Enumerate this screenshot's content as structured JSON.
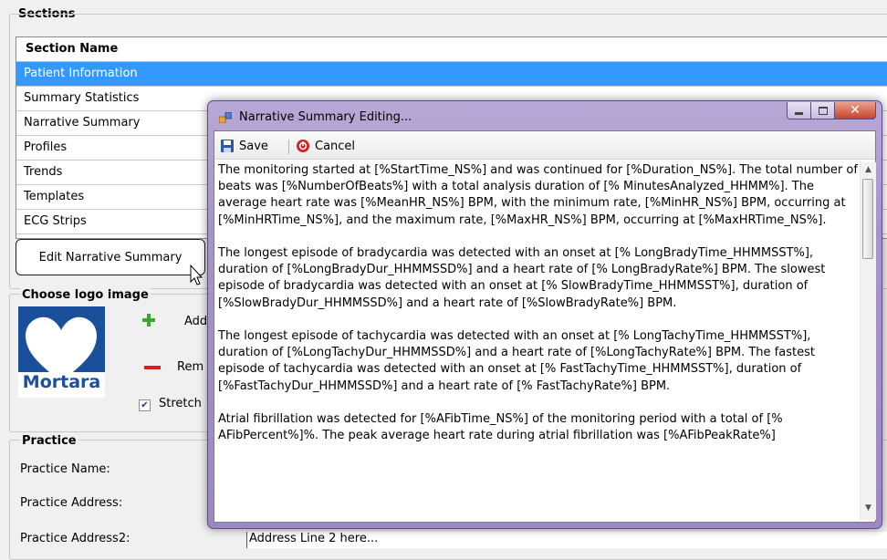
{
  "sections": {
    "title": "Sections",
    "column_header": "Section Name",
    "rows": [
      "Patient Information",
      "Summary Statistics",
      "Narrative Summary",
      "Profiles",
      "Trends",
      "Templates",
      "ECG Strips"
    ],
    "selected_index": 0,
    "edit_button": "Edit Narrative Summary"
  },
  "logo": {
    "title": "Choose logo image",
    "brand_text": "Mortara",
    "add_label": "Add",
    "remove_label": "Rem",
    "stretch_label": "Stretch",
    "stretch_checked": true
  },
  "practice": {
    "title": "Practice",
    "name_label": "Practice Name:",
    "address_label": "Practice Address:",
    "address2_label": "Practice Address2:",
    "address2_value": "Address Line 2 here..."
  },
  "dialog": {
    "title": "Narrative Summary Editing...",
    "save_label": "Save",
    "cancel_label": "Cancel",
    "paragraphs": [
      "The monitoring started at [%StartTime_NS%] and was continued for [%Duration_NS%].  The total number of beats was [%NumberOfBeats%] with a total analysis duration of [% MinutesAnalyzed_HHMM%].  The average heart rate was [%MeanHR_NS%] BPM, with the minimum rate, [%MinHR_NS%] BPM, occurring at [%MinHRTime_NS%], and the maximum rate, [%MaxHR_NS%] BPM, occurring at [%MaxHRTime_NS%].",
      "The longest episode of bradycardia was detected with an onset at [% LongBradyTime_HHMMSST%], duration of [%LongBradyDur_HHMMSSD%] and a heart rate of [% LongBradyRate%] BPM.  The slowest episode of bradycardia was detected with an onset at [% SlowBradyTime_HHMMSST%], duration of [%SlowBradyDur_HHMMSSD%] and a heart rate of [%SlowBradyRate%] BPM.",
      "The longest episode of tachycardia was detected with an onset at [% LongTachyTime_HHMMSST%], duration of [%LongTachyDur_HHMMSSD%] and a heart rate of [%LongTachyRate%] BPM.  The fastest episode of tachycardia was detected with an onset at [% FastTachyTime_HHMMSST%], duration of [%FastTachyDur_HHMMSSD%] and a heart rate of [% FastTachyRate%] BPM.",
      "Atrial fibrillation was detected for [%AFibTime_NS%] of the monitoring period with a total of [% AFibPercent%]%.  The peak average heart rate during atrial fibrillation was [%AFibPeakRate%]"
    ],
    "scroll_position": 0
  },
  "colors": {
    "selection": "#3399ff",
    "dialog_frame": "#a793cc",
    "logo_blue": "#1a4f9c"
  }
}
